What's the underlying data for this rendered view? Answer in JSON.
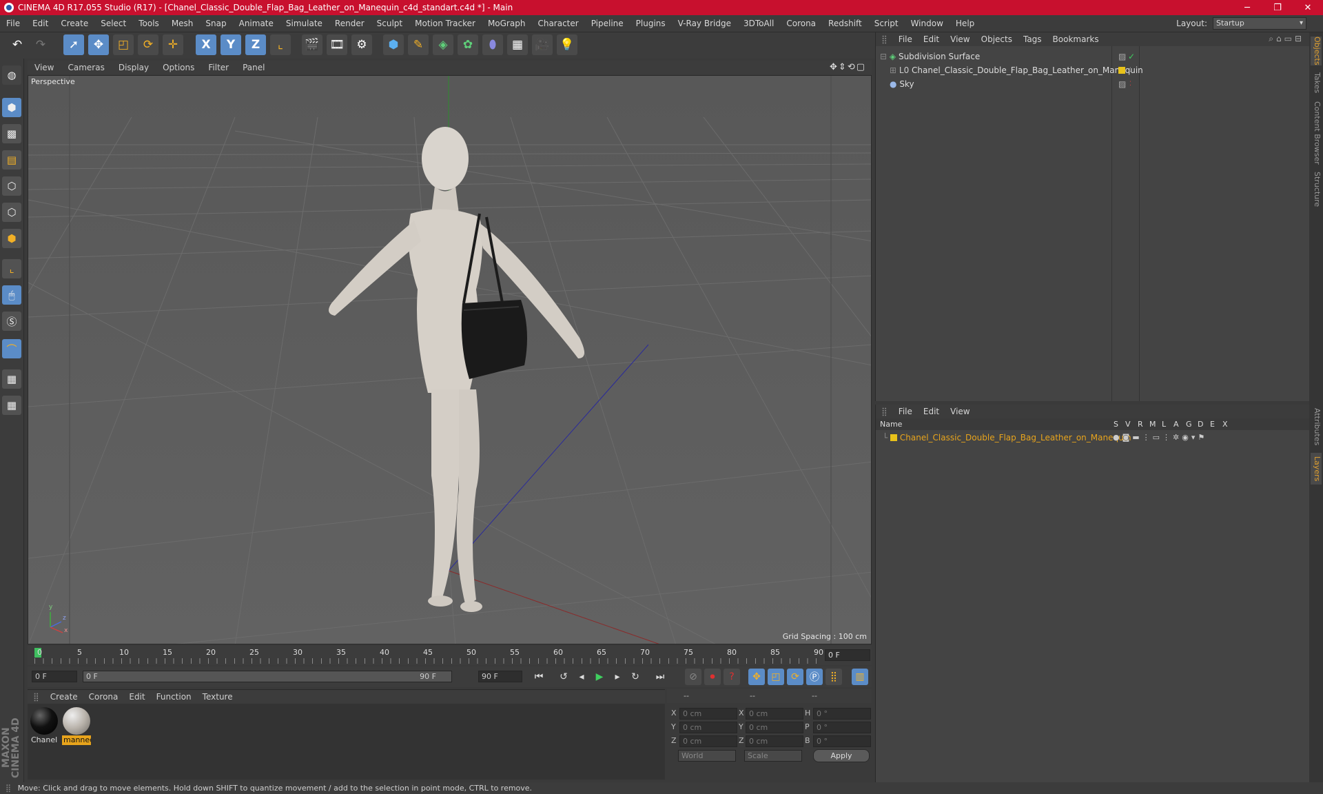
{
  "window": {
    "title": "CINEMA 4D R17.055 Studio (R17) - [Chanel_Classic_Double_Flap_Bag_Leather_on_Manequin_c4d_standart.c4d *] - Main",
    "minimize": "─",
    "maximize": "❐",
    "close": "✕"
  },
  "menu": [
    "File",
    "Edit",
    "Create",
    "Select",
    "Tools",
    "Mesh",
    "Snap",
    "Animate",
    "Simulate",
    "Render",
    "Sculpt",
    "Motion Tracker",
    "MoGraph",
    "Character",
    "Pipeline",
    "Plugins",
    "V-Ray Bridge",
    "3DToAll",
    "Corona",
    "Redshift",
    "Script",
    "Window",
    "Help"
  ],
  "layout": {
    "label": "Layout:",
    "value": "Startup"
  },
  "toolbar": {
    "axis_x": "X",
    "axis_y": "Y",
    "axis_z": "Z"
  },
  "viewport": {
    "menu": [
      "View",
      "Cameras",
      "Display",
      "Options",
      "Filter",
      "Panel"
    ],
    "label": "Perspective",
    "grid_spacing": "Grid Spacing : 100 cm",
    "axis_y": "y",
    "axis_z": "z",
    "axis_x": "x"
  },
  "timeline": {
    "ticks": [
      "0",
      "5",
      "10",
      "15",
      "20",
      "25",
      "30",
      "35",
      "40",
      "45",
      "50",
      "55",
      "60",
      "65",
      "70",
      "75",
      "80",
      "85",
      "90"
    ],
    "current_frame": "0 F",
    "start_field": "0 F",
    "range_start": "0 F",
    "range_end": "90 F",
    "end_field": "90 F"
  },
  "materials": {
    "menu": [
      "Create",
      "Corona",
      "Edit",
      "Function",
      "Texture"
    ],
    "items": [
      {
        "label": "Chanel",
        "color": "#111111"
      },
      {
        "label": "manneq",
        "color": "#b8b2aa"
      }
    ]
  },
  "coordinates": {
    "header": [
      "--",
      "--",
      "--"
    ],
    "rows": [
      {
        "axis": "X",
        "pos": "0 cm",
        "axis2": "X",
        "size": "0 cm",
        "rot_label": "H",
        "rot": "0 °"
      },
      {
        "axis": "Y",
        "pos": "0 cm",
        "axis2": "Y",
        "size": "0 cm",
        "rot_label": "P",
        "rot": "0 °"
      },
      {
        "axis": "Z",
        "pos": "0 cm",
        "axis2": "Z",
        "size": "0 cm",
        "rot_label": "B",
        "rot": "0 °"
      }
    ],
    "mode": "World",
    "mode2": "Scale",
    "apply": "Apply"
  },
  "objects": {
    "menu": [
      "File",
      "Edit",
      "View",
      "Objects",
      "Tags",
      "Bookmarks"
    ],
    "items": [
      {
        "name": "Subdivision Surface"
      },
      {
        "name": "Chanel_Classic_Double_Flap_Bag_Leather_on_Manequin"
      },
      {
        "name": "Sky"
      }
    ]
  },
  "layers": {
    "menu": [
      "File",
      "Edit",
      "View"
    ],
    "header": {
      "name": "Name",
      "cols": [
        "S",
        "V",
        "R",
        "M",
        "L",
        "A",
        "G",
        "D",
        "E",
        "X"
      ]
    },
    "items": [
      {
        "name": "Chanel_Classic_Double_Flap_Bag_Leather_on_Manequin",
        "color": "#e8c21a"
      }
    ]
  },
  "right_tabs": [
    "Objects",
    "Takes",
    "Content Browser",
    "Structure",
    "Attributes",
    "Layers"
  ],
  "status": "Move: Click and drag to move elements. Hold down SHIFT to quantize movement / add to the selection in point mode, CTRL to remove.",
  "brand": "MAXON CINEMA 4D"
}
